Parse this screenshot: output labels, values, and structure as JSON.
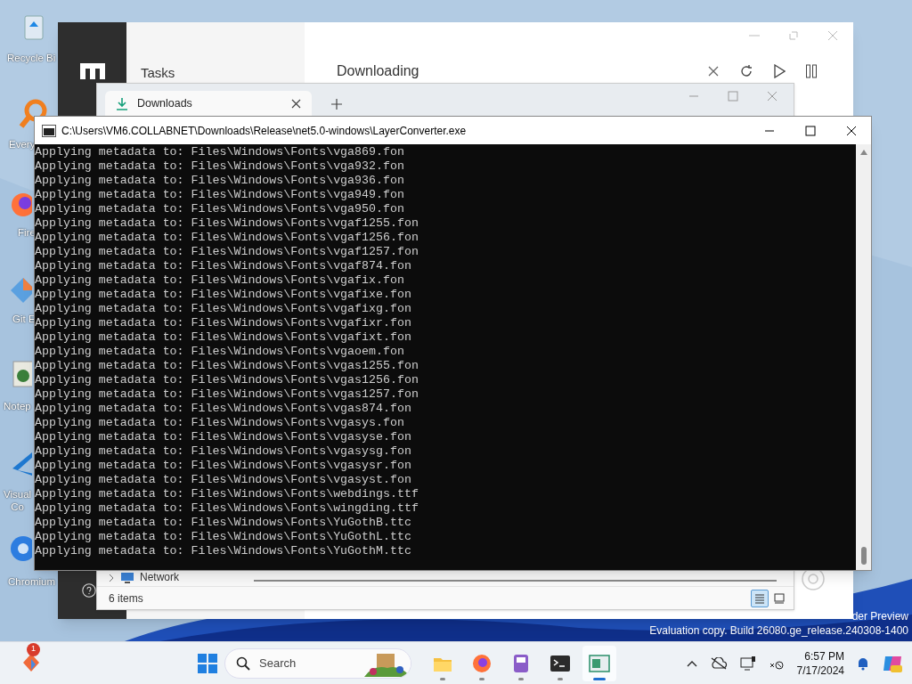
{
  "desktop_icons": [
    {
      "kind": "recycle",
      "lines": [
        "Recycle Bi"
      ]
    },
    {
      "kind": "search",
      "lines": [
        "Every"
      ]
    },
    {
      "kind": "fox",
      "lines": [
        "Fire"
      ]
    },
    {
      "kind": "git",
      "lines": [
        "Git E"
      ]
    },
    {
      "kind": "notepad",
      "lines": [
        "Notep"
      ]
    },
    {
      "kind": "code",
      "lines": [
        "Visual",
        "Co"
      ]
    },
    {
      "kind": "chromium",
      "lines": [
        "Chromium"
      ]
    }
  ],
  "motrix": {
    "panel_title": "Tasks",
    "title": "Downloading"
  },
  "explorer": {
    "tab": "Downloads",
    "nav_item": "Network",
    "status": "6 items",
    "views": [
      {
        "kind": "details",
        "selected": true
      },
      {
        "kind": "tiles",
        "selected": false
      }
    ]
  },
  "console": {
    "title": "C:\\Users\\VM6.COLLABNET\\Downloads\\Release\\net5.0-windows\\LayerConverter.exe",
    "lines": [
      "Applying metadata to: Files\\Windows\\Fonts\\vga869.fon",
      "Applying metadata to: Files\\Windows\\Fonts\\vga932.fon",
      "Applying metadata to: Files\\Windows\\Fonts\\vga936.fon",
      "Applying metadata to: Files\\Windows\\Fonts\\vga949.fon",
      "Applying metadata to: Files\\Windows\\Fonts\\vga950.fon",
      "Applying metadata to: Files\\Windows\\Fonts\\vgaf1255.fon",
      "Applying metadata to: Files\\Windows\\Fonts\\vgaf1256.fon",
      "Applying metadata to: Files\\Windows\\Fonts\\vgaf1257.fon",
      "Applying metadata to: Files\\Windows\\Fonts\\vgaf874.fon",
      "Applying metadata to: Files\\Windows\\Fonts\\vgafix.fon",
      "Applying metadata to: Files\\Windows\\Fonts\\vgafixe.fon",
      "Applying metadata to: Files\\Windows\\Fonts\\vgafixg.fon",
      "Applying metadata to: Files\\Windows\\Fonts\\vgafixr.fon",
      "Applying metadata to: Files\\Windows\\Fonts\\vgafixt.fon",
      "Applying metadata to: Files\\Windows\\Fonts\\vgaoem.fon",
      "Applying metadata to: Files\\Windows\\Fonts\\vgas1255.fon",
      "Applying metadata to: Files\\Windows\\Fonts\\vgas1256.fon",
      "Applying metadata to: Files\\Windows\\Fonts\\vgas1257.fon",
      "Applying metadata to: Files\\Windows\\Fonts\\vgas874.fon",
      "Applying metadata to: Files\\Windows\\Fonts\\vgasys.fon",
      "Applying metadata to: Files\\Windows\\Fonts\\vgasyse.fon",
      "Applying metadata to: Files\\Windows\\Fonts\\vgasysg.fon",
      "Applying metadata to: Files\\Windows\\Fonts\\vgasysr.fon",
      "Applying metadata to: Files\\Windows\\Fonts\\vgasyst.fon",
      "Applying metadata to: Files\\Windows\\Fonts\\webdings.ttf",
      "Applying metadata to: Files\\Windows\\Fonts\\wingding.ttf",
      "Applying metadata to: Files\\Windows\\Fonts\\YuGothB.ttc",
      "Applying metadata to: Files\\Windows\\Fonts\\YuGothL.ttc",
      "Applying metadata to: Files\\Windows\\Fonts\\YuGothM.ttc"
    ]
  },
  "watermark": [
    "der Preview",
    "Evaluation copy. Build 26080.ge_release.240308-1400"
  ],
  "taskbar": {
    "badge": "1",
    "search_placeholder": "Search",
    "apps": [
      {
        "kind": "folder",
        "selected": false
      },
      {
        "kind": "fox",
        "selected": false
      },
      {
        "kind": "device",
        "selected": false
      },
      {
        "kind": "terminal",
        "selected": false
      },
      {
        "kind": "window",
        "selected": true
      }
    ],
    "time": "6:57 PM",
    "date": "7/17/2024"
  }
}
